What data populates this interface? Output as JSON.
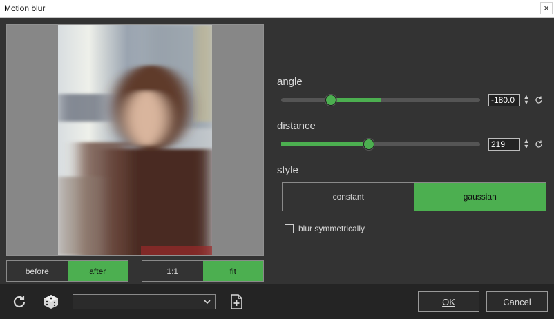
{
  "window": {
    "title": "Motion blur",
    "close_glyph": "×"
  },
  "preview": {
    "before_label": "before",
    "after_label": "after",
    "one_to_one_label": "1:1",
    "fit_label": "fit",
    "active_view": "after",
    "active_zoom": "fit"
  },
  "angle": {
    "label": "angle",
    "value": "-180.0",
    "slider_fraction": 0.25,
    "center_fraction": 0.5
  },
  "distance": {
    "label": "distance",
    "value": "219",
    "slider_fraction": 0.44
  },
  "style": {
    "label": "style",
    "options": [
      "constant",
      "gaussian"
    ],
    "selected": "gaussian"
  },
  "blur_symmetrically": {
    "label": "blur symmetrically",
    "checked": false
  },
  "footer": {
    "reset_icon": "reset-icon",
    "random_icon": "dice-icon",
    "preset_value": "",
    "new_preset_icon": "new-document-icon",
    "ok_label": "OK",
    "cancel_label": "Cancel"
  },
  "colors": {
    "accent": "#4caf50",
    "background": "#333333",
    "footer": "#242424"
  }
}
